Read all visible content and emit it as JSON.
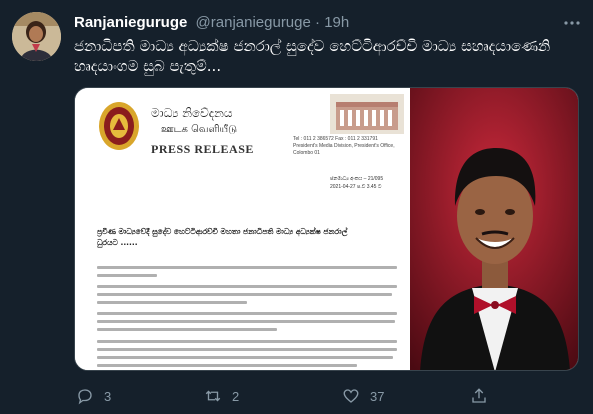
{
  "tweet": {
    "display_name": "Ranjanieguruge",
    "handle": "@ranjanieguruge",
    "separator": "·",
    "time": "19h",
    "text": "ජනාධිපති මාධ්‍ය අධ්‍යක්ෂ ජනරාල් සුදේව හෙට්ටිආරච්චි මාධ්‍ය සහෘදයාණෙනි හෘදයාංගම සුබ පැතුම්...",
    "more_icon": "ellipsis-icon"
  },
  "media": {
    "document": {
      "brand_line1": "මාධ්‍ය නිවේදනය",
      "brand_line2": "ஊடக வெளியீடு",
      "brand_line3": "PRESS RELEASE",
      "contact_line1": "Tel : 011 2 386572    Fax : 011 2 331791",
      "contact_line2": "President's Media Division, President's Office, Colombo 01",
      "ref_line1": "ජනමාධ්‍ය අංකය – 21/095",
      "ref_line2": "2021-04-27 ප.ව 3.45 ට",
      "heading": "ප්‍රවීණ මාධ්‍යවේදී සුදේව හෙට්ටිආරච්චි මහතා ජනාධිපති මාධ්‍ය අධ්‍යක්ෂ ජනරාල් ධුරයට ......"
    }
  },
  "actions": {
    "reply_count": "3",
    "retweet_count": "2",
    "like_count": "37",
    "reply_icon": "reply-icon",
    "retweet_icon": "retweet-icon",
    "like_icon": "heart-icon",
    "share_icon": "share-icon"
  },
  "colors": {
    "background": "#15202b",
    "secondary_text": "#8899a6"
  }
}
